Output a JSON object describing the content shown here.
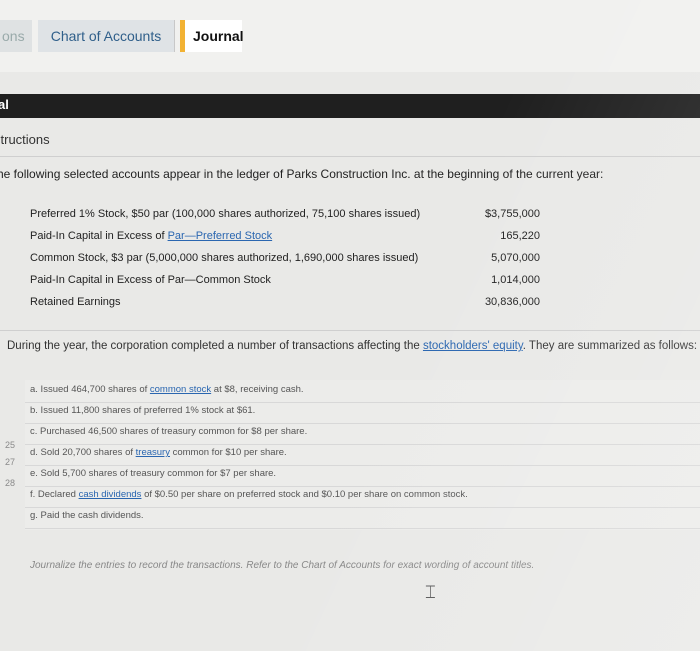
{
  "tabs": {
    "partial": "ons",
    "chart_of_accounts": "Chart of Accounts",
    "journal": "Journal"
  },
  "section_header": "al",
  "instructions": {
    "heading": "structions",
    "intro": "he following selected accounts appear in the ledger of Parks Construction Inc. at the beginning of the current year:"
  },
  "ledger": [
    {
      "label": "Preferred 1% Stock, $50 par (100,000 shares authorized, 75,100 shares issued)",
      "value": "$3,755,000"
    },
    {
      "label_prefix": "Paid-In Capital in Excess of ",
      "label_link": "Par—Preferred Stock",
      "value": "165,220"
    },
    {
      "label": "Common Stock, $3 par (5,000,000 shares authorized, 1,690,000 shares issued)",
      "value": "5,070,000"
    },
    {
      "label": "Paid-In Capital in Excess of Par—Common Stock",
      "value": "1,014,000"
    },
    {
      "label": "Retained Earnings",
      "value": "30,836,000"
    }
  ],
  "during": {
    "prefix": "During the year, the corporation completed a number of transactions affecting the ",
    "link": "stockholders' equity",
    "suffix": ". They are summarized as follows:"
  },
  "transactions": [
    {
      "prefix": "a. Issued 464,700 shares of ",
      "link": "common stock",
      "suffix": " at $8, receiving cash."
    },
    {
      "prefix": "b. Issued 11,800 shares of preferred 1% stock at $61.",
      "link": "",
      "suffix": ""
    },
    {
      "prefix": "c. Purchased 46,500 shares of treasury common for $8 per share.",
      "link": "",
      "suffix": ""
    },
    {
      "prefix": "d. Sold 20,700 shares of ",
      "link": "treasury",
      "suffix": " common for $10 per share."
    },
    {
      "prefix": "e. Sold 5,700 shares of treasury common for $7 per share.",
      "link": "",
      "suffix": ""
    },
    {
      "prefix": "f. Declared ",
      "link": "cash dividends",
      "suffix": " of $0.50 per share on preferred stock and $0.10 per share on common stock."
    },
    {
      "prefix": "g. Paid the cash dividends.",
      "link": "",
      "suffix": ""
    }
  ],
  "margin_numbers": [
    "25",
    "27",
    "28"
  ],
  "journal_note": "Journalize the entries to record the transactions. Refer to the Chart of Accounts for exact wording of account titles.",
  "colors": {
    "link": "#2a66b0",
    "journal_accent": "#f2b233",
    "dark_bar": "#1f1f1f"
  }
}
